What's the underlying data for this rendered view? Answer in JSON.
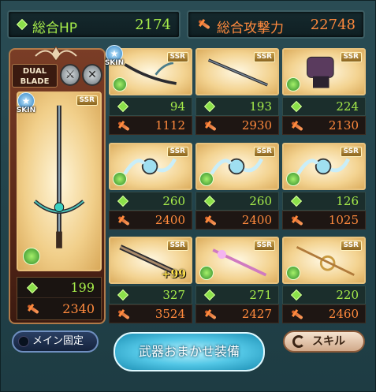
{
  "header": {
    "hp_label": "総合HP",
    "hp_value": "2174",
    "atk_label": "総合攻撃力",
    "atk_value": "22748"
  },
  "main_weapon": {
    "type_badge": "DUAL\nBLADE",
    "type_line1": "DUAL",
    "type_line2": "BLADE",
    "skin_label": "SKIN",
    "skin_label_main": "SKIN",
    "rarity": "SSR",
    "hp": "199",
    "atk": "2340",
    "element": "wind"
  },
  "grid": [
    {
      "rarity": "SSR",
      "hp": "94",
      "atk": "1112",
      "plus": "",
      "element": "wind",
      "art": "hook-blade"
    },
    {
      "rarity": "SSR",
      "hp": "193",
      "atk": "2930",
      "plus": "",
      "element": "",
      "art": "spear"
    },
    {
      "rarity": "SSR",
      "hp": "224",
      "atk": "2130",
      "plus": "",
      "element": "wind",
      "art": "gauntlet"
    },
    {
      "rarity": "SSR",
      "hp": "260",
      "atk": "2400",
      "plus": "",
      "element": "wind",
      "art": "orb-wing"
    },
    {
      "rarity": "SSR",
      "hp": "260",
      "atk": "2400",
      "plus": "",
      "element": "wind",
      "art": "orb-wing"
    },
    {
      "rarity": "SSR",
      "hp": "126",
      "atk": "1025",
      "plus": "",
      "element": "wind",
      "art": "orb-wing"
    },
    {
      "rarity": "SSR",
      "hp": "327",
      "atk": "3524",
      "plus": "+99",
      "element": "",
      "art": "greatsword"
    },
    {
      "rarity": "SSR",
      "hp": "271",
      "atk": "2427",
      "plus": "",
      "element": "wind",
      "art": "staff"
    },
    {
      "rarity": "SSR",
      "hp": "220",
      "atk": "2460",
      "plus": "",
      "element": "wind",
      "art": "ring-staff"
    }
  ],
  "buttons": {
    "lock_main": "メイン固定",
    "auto_equip": "武器おまかせ装備",
    "skill": "スキル"
  },
  "colors": {
    "hp": "#a6ec4a",
    "atk": "#ff8a3d",
    "panel": "#22434b"
  }
}
